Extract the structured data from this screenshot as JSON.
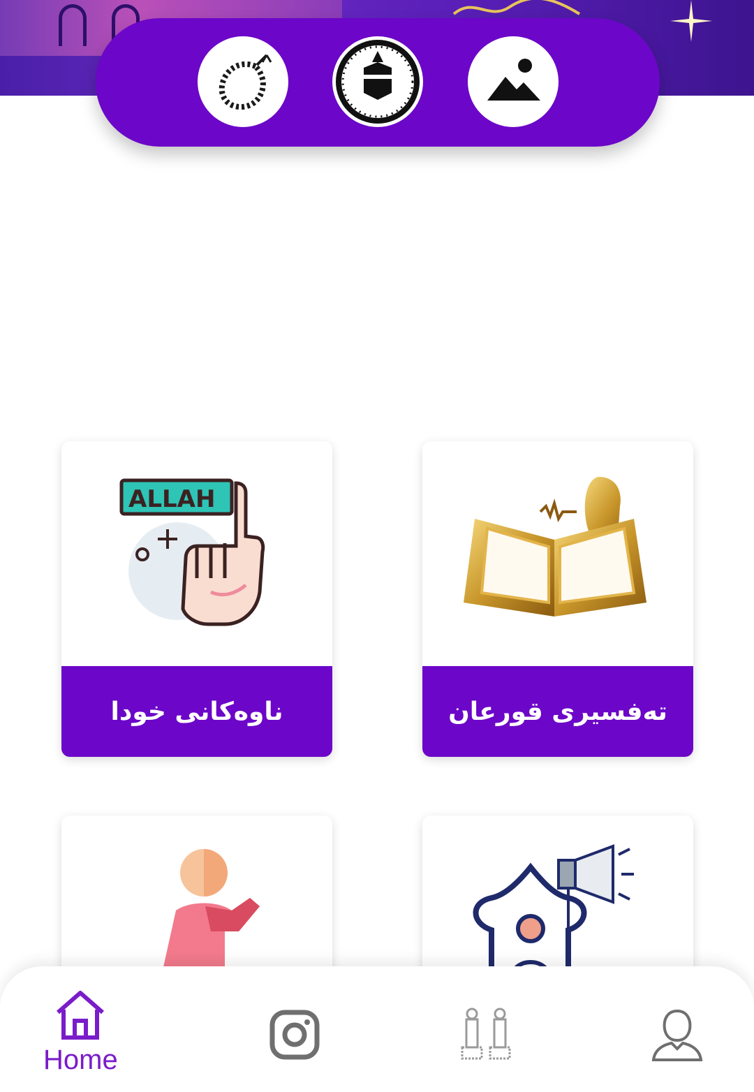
{
  "header": {
    "quick_actions": [
      {
        "name": "tasbih",
        "icon": "prayer-beads-icon"
      },
      {
        "name": "qibla",
        "icon": "kaaba-compass-icon"
      },
      {
        "name": "gallery",
        "icon": "image-icon"
      }
    ]
  },
  "cards": [
    {
      "label": "ناوەکانی خودا",
      "icon": "allah-hand-icon",
      "badge": "ALLAH"
    },
    {
      "label": "تەفسیری قورعان",
      "icon": "quran-reciter-icon"
    },
    {
      "label": "",
      "icon": "praying-person-icon"
    },
    {
      "label": "",
      "icon": "mosque-megaphone-icon"
    }
  ],
  "bottom_nav": {
    "items": [
      {
        "name": "home",
        "label": "Home",
        "icon": "home-icon",
        "active": true
      },
      {
        "name": "instagram",
        "icon": "instagram-icon"
      },
      {
        "name": "prayer",
        "icon": "prayer-figures-icon"
      },
      {
        "name": "profile",
        "icon": "user-icon"
      }
    ]
  },
  "colors": {
    "primary": "#6c06c8",
    "active_nav": "#7a1cc9",
    "inactive_nav": "#6f6f6f"
  }
}
